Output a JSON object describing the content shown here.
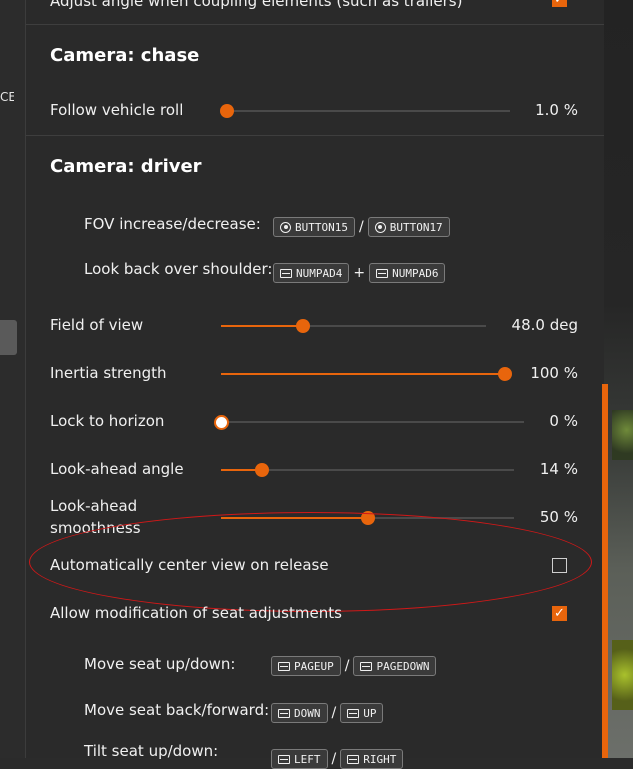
{
  "left_panel": {
    "clipped_text": "CE"
  },
  "top_row": {
    "label": "Adjust angle when coupling elements (such as trailers)",
    "checked": true
  },
  "chase": {
    "title": "Camera: chase",
    "follow_roll": {
      "label": "Follow vehicle roll",
      "value": "1.0 %",
      "fraction": 0.01
    }
  },
  "driver": {
    "title": "Camera: driver",
    "fov_binding": {
      "label": "FOV increase/decrease:",
      "key1": "BUTTON15",
      "sep": "/",
      "key2": "BUTTON17"
    },
    "look_back": {
      "label": "Look back over shoulder:",
      "key1": "NUMPAD4",
      "sep": "+",
      "key2": "NUMPAD6"
    },
    "field_of_view": {
      "label": "Field of view",
      "value": "48.0 deg",
      "fraction": 0.31
    },
    "inertia": {
      "label": "Inertia strength",
      "value": "100 %",
      "fraction": 1.0
    },
    "lock_horizon": {
      "label": "Lock to horizon",
      "value": "0 %",
      "fraction": 0.0
    },
    "look_ahead_angle": {
      "label": "Look-ahead angle",
      "value": "14 %",
      "fraction": 0.14
    },
    "look_ahead_smooth": {
      "label_line1": "Look-ahead",
      "label_line2": "smoothness",
      "value": "50 %",
      "fraction": 0.5
    },
    "auto_center": {
      "label": "Automatically center view on release",
      "checked": false
    },
    "seat_mod": {
      "label": "Allow modification of seat adjustments",
      "checked": true
    },
    "seat_updown": {
      "label": "Move seat up/down:",
      "key1": "PAGEUP",
      "sep": "/",
      "key2": "PAGEDOWN"
    },
    "seat_backfwd": {
      "label": "Move seat back/forward:",
      "key1": "DOWN",
      "sep": "/",
      "key2": "UP"
    },
    "seat_tilt": {
      "label": "Tilt seat up/down:",
      "key1": "LEFT",
      "sep": "/",
      "key2": "RIGHT"
    }
  },
  "colors": {
    "accent": "#e8650c",
    "annotation": "#d01818",
    "panel": "#2a2a2a"
  }
}
